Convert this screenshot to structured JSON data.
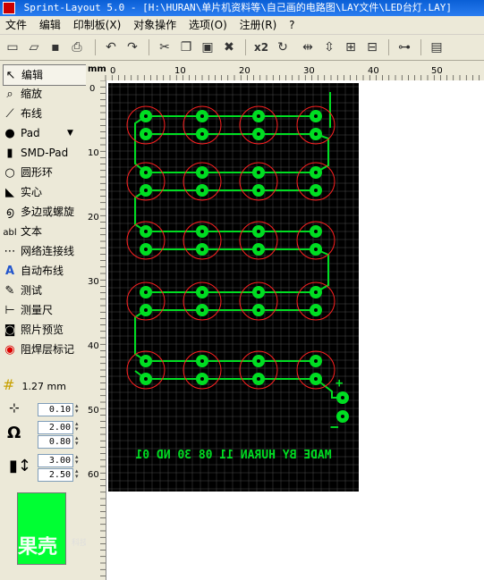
{
  "window": {
    "title": "Sprint-Layout 5.0 - [H:\\HURAN\\单片机资料等\\自己画的电路图\\LAY文件\\LED台灯.LAY]"
  },
  "menu": {
    "items": [
      "文件",
      "编辑",
      "印制板(X)",
      "对象操作",
      "选项(O)",
      "注册(R)",
      "?"
    ]
  },
  "toolbar": {
    "icons": [
      "new-icon",
      "open-icon",
      "save-icon",
      "print-icon",
      "undo-icon",
      "redo-icon",
      "cut-icon",
      "copy-icon",
      "paste-icon",
      "delete-icon",
      "duplicate-x2-icon",
      "rotate-icon",
      "mirror-h-icon",
      "mirror-v-icon",
      "align-icon",
      "group-icon",
      "ungroup-icon"
    ],
    "x2_label": "x2"
  },
  "tools": [
    {
      "label": "编辑",
      "icon": "arrow-icon",
      "glyph": "↖"
    },
    {
      "label": "缩放",
      "icon": "zoom-icon",
      "glyph": "⌕"
    },
    {
      "label": "布线",
      "icon": "track-icon",
      "glyph": "⟋"
    },
    {
      "label": "Pad",
      "icon": "pad-icon",
      "glyph": "●"
    },
    {
      "label": "SMD-Pad",
      "icon": "smd-pad-icon",
      "glyph": "▮"
    },
    {
      "label": "圆形环",
      "icon": "ring-icon",
      "glyph": "○"
    },
    {
      "label": "实心",
      "icon": "fill-icon",
      "glyph": "◣"
    },
    {
      "label": "多边或螺旋",
      "icon": "polygon-icon",
      "glyph": "൭"
    },
    {
      "label": "文本",
      "icon": "text-icon",
      "glyph": "abl"
    },
    {
      "label": "网络连接线",
      "icon": "connection-icon",
      "glyph": "⋯"
    },
    {
      "label": "自动布线",
      "icon": "autoroute-icon",
      "glyph": "A"
    },
    {
      "label": "测试",
      "icon": "test-icon",
      "glyph": "✎"
    },
    {
      "label": "测量尺",
      "icon": "ruler-icon",
      "glyph": "⊢"
    },
    {
      "label": "照片预览",
      "icon": "camera-icon",
      "glyph": "◙"
    },
    {
      "label": "阻焊层标记",
      "icon": "solder-mask-icon",
      "glyph": "◉"
    }
  ],
  "grid": {
    "value": "1.27 mm"
  },
  "params": {
    "track_width": "0.10",
    "pad_outer": "2.00",
    "pad_inner": "0.80",
    "smd_w": "3.00",
    "smd_h": "2.50"
  },
  "ruler": {
    "unit": "mm",
    "h_ticks": [
      "0",
      "10",
      "20",
      "30",
      "40",
      "50"
    ],
    "v_ticks": [
      "0",
      "10",
      "20",
      "30",
      "40",
      "50",
      "60"
    ]
  },
  "pcb": {
    "text": "MADE BY HURAN 11 08 30 ND 01",
    "plus": "+",
    "minus": "−",
    "colors": {
      "copper": "#00dd22",
      "ring": "#ff2020",
      "board": "#000000",
      "grid": "#5a5a5a"
    }
  },
  "watermark": {
    "main": "果壳",
    "sub": "科技有意思"
  }
}
